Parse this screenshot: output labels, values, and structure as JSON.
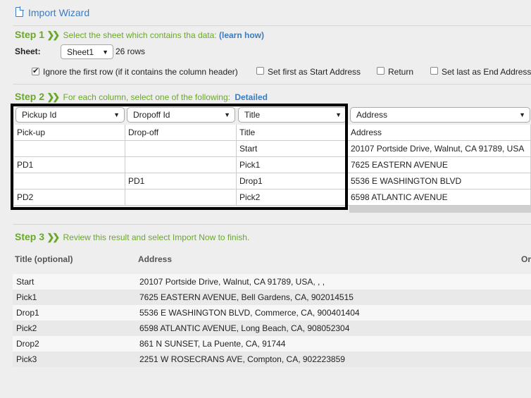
{
  "wizard": {
    "title": "Import Wizard"
  },
  "step1": {
    "label": "Step 1",
    "text": "Select the sheet which contains tha data:",
    "link": "(learn how)",
    "sheet_label": "Sheet:",
    "sheet_value": "Sheet1",
    "rows_text": "26 rows",
    "options": [
      {
        "label": "Ignore the first row (if it contains the column header)",
        "checked": true
      },
      {
        "label": "Set first as Start Address",
        "checked": false
      },
      {
        "label": "Return",
        "checked": false
      },
      {
        "label": "Set last as End Address",
        "checked": false
      }
    ]
  },
  "step2": {
    "label": "Step 2",
    "text": "For each column, select one of the following:",
    "link": "Detailed",
    "columns": [
      "Pickup Id",
      "Dropoff Id",
      "Title",
      "Address"
    ],
    "rows": [
      [
        "Pick-up",
        "Drop-off",
        "Title",
        "Address"
      ],
      [
        "",
        "",
        "Start",
        "20107 Portside Drive, Walnut, CA 91789, USA"
      ],
      [
        "PD1",
        "",
        "Pick1",
        "7625 EASTERN AVENUE"
      ],
      [
        "",
        "PD1",
        "Drop1",
        "5536 E WASHINGTON BLVD"
      ],
      [
        "PD2",
        "",
        "Pick2",
        "6598 ATLANTIC AVENUE"
      ]
    ]
  },
  "step3": {
    "label": "Step 3",
    "text": "Review this result and select Import Now to finish.",
    "headers": [
      "Title (optional)",
      "Address",
      "Or"
    ],
    "rows": [
      [
        "Start",
        "20107 Portside Drive, Walnut, CA 91789, USA, , ,"
      ],
      [
        "Pick1",
        "7625 EASTERN AVENUE, Bell Gardens, CA, 902014515"
      ],
      [
        "Drop1",
        "5536 E WASHINGTON BLVD, Commerce, CA, 900401404"
      ],
      [
        "Pick2",
        "6598 ATLANTIC AVENUE, Long Beach, CA, 908052304"
      ],
      [
        "Drop2",
        "861 N SUNSET, La Puente, CA, 91744"
      ],
      [
        "Pick3",
        "2251 W ROSECRANS AVE, Compton, CA, 902223859"
      ]
    ]
  }
}
